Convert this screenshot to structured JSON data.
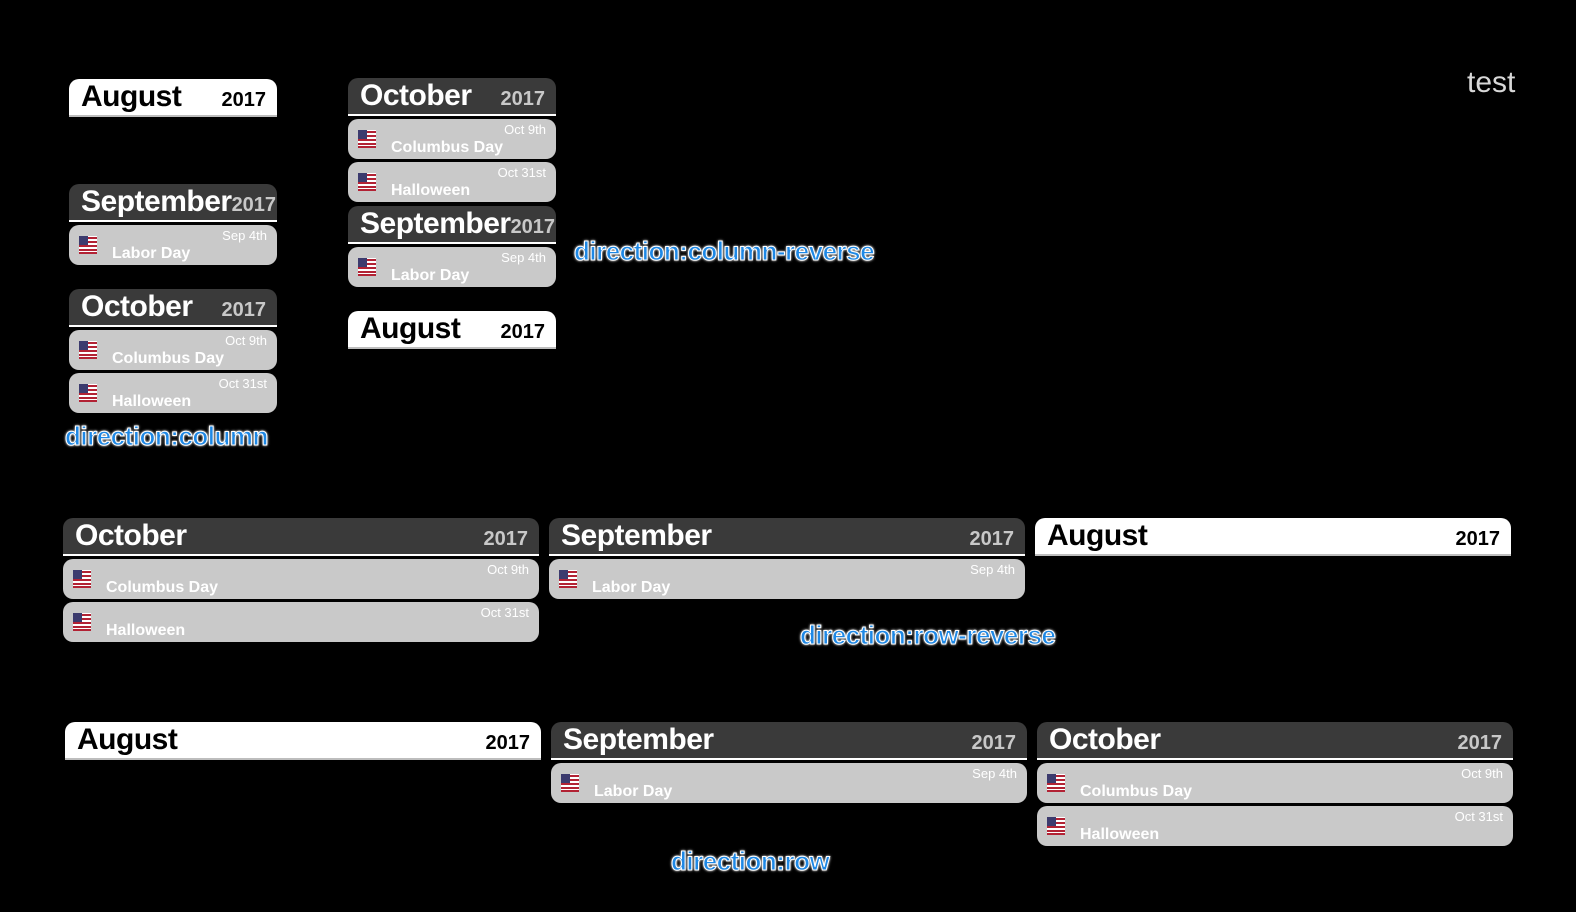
{
  "corner_text": "test",
  "labels": {
    "column": "direction:column",
    "column_reverse": "direction:column-reverse",
    "row_reverse": "direction:row-reverse",
    "row": "direction:row"
  },
  "months": {
    "august": {
      "name": "August",
      "year": "2017"
    },
    "september": {
      "name": "September",
      "year": "2017"
    },
    "october": {
      "name": "October",
      "year": "2017"
    }
  },
  "events": {
    "labor_day": {
      "name": "Labor Day",
      "date": "Sep 4th",
      "icon": "us-flag-icon"
    },
    "columbus_day": {
      "name": "Columbus Day",
      "date": "Oct 9th",
      "icon": "us-flag-icon"
    },
    "halloween": {
      "name": "Halloween",
      "date": "Oct 31st",
      "icon": "us-flag-icon"
    }
  },
  "colors": {
    "background": "#000000",
    "header_dark": "#3a3a3a",
    "header_light": "#ffffff",
    "event_bg": "#c9c9c9",
    "label_blue": "#1e88e5"
  }
}
